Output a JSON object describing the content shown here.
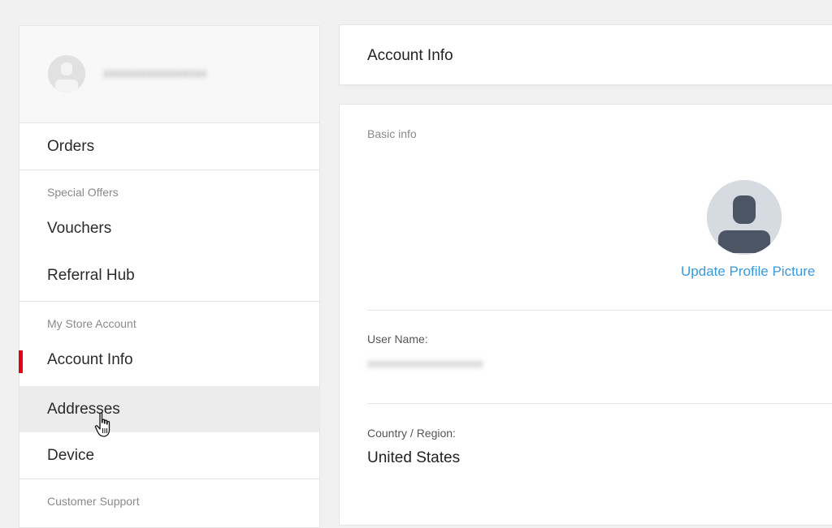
{
  "sidebar": {
    "profile": {
      "avatar_icon": "user-avatar-icon",
      "name_redacted": "redacted-name"
    },
    "items": {
      "orders": "Orders",
      "special_offers_heading": "Special Offers",
      "vouchers": "Vouchers",
      "referral_hub": "Referral Hub",
      "my_store_account_heading": "My Store Account",
      "account_info": "Account Info",
      "addresses": "Addresses",
      "device": "Device",
      "customer_support_heading": "Customer Support"
    }
  },
  "header": {
    "title": "Account Info"
  },
  "content": {
    "section_label": "Basic info",
    "update_picture_label": "Update Profile Picture",
    "user_name_label": "User Name:",
    "user_name_value_redacted": "redacted-username",
    "country_label": "Country / Region:",
    "country_value": "United States"
  },
  "colors": {
    "accent_active": "#e4001b",
    "link": "#3a9ad9",
    "avatar_bg": "#d5dbe0",
    "avatar_fg": "#4b5563"
  }
}
